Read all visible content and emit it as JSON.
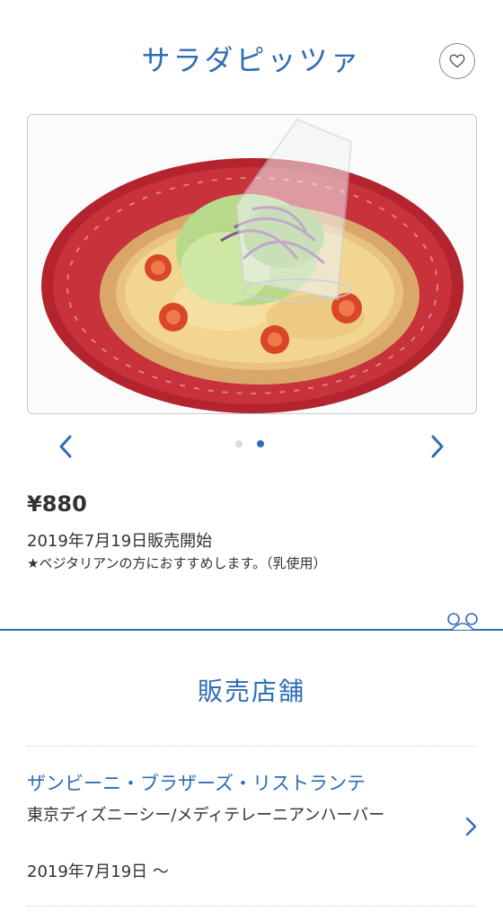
{
  "header": {
    "title": "サラダピッツァ",
    "favorite_icon": "heart-icon"
  },
  "carousel": {
    "prev_icon": "chevron-left-icon",
    "next_icon": "chevron-right-icon",
    "page_count": 2,
    "active_page": 2,
    "image_description_icon": "pizza-photo"
  },
  "product": {
    "price": "¥880",
    "release": "2019年7月19日販売開始",
    "note": "★ベジタリアンの方におすすめします。（乳使用）"
  },
  "stores": {
    "title": "販売店舗",
    "items": [
      {
        "name": "ザンビーニ・ブラザーズ・リストランテ",
        "location": "東京ディズニーシー/メディテレーニアンハーバー",
        "date": "2019年7月19日 ～"
      }
    ]
  },
  "colors": {
    "accent": "#2e6db4",
    "text": "#333333",
    "divider": "#2e6db4"
  }
}
